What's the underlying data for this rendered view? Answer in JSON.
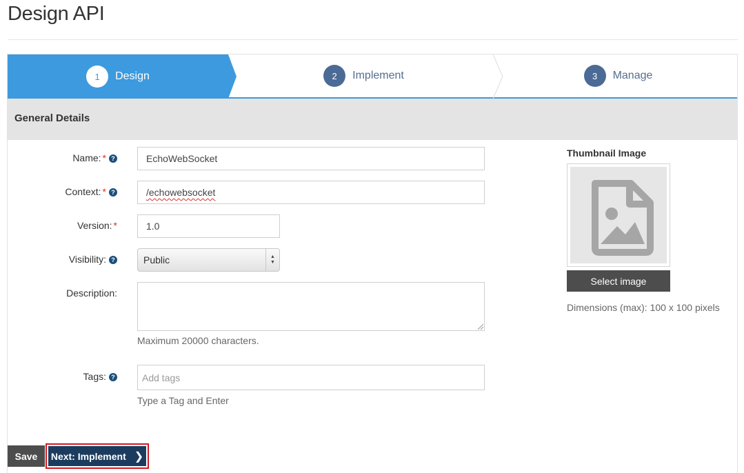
{
  "page": {
    "title": "Design API"
  },
  "wizard": {
    "steps": [
      {
        "number": "1",
        "label": "Design",
        "active": true
      },
      {
        "number": "2",
        "label": "Implement",
        "active": false
      },
      {
        "number": "3",
        "label": "Manage",
        "active": false
      }
    ]
  },
  "section": {
    "title": "General Details"
  },
  "form": {
    "name": {
      "label": "Name:",
      "value": "EchoWebSocket",
      "required": true
    },
    "context": {
      "label": "Context:",
      "value": "/echowebsocket",
      "required": true
    },
    "version": {
      "label": "Version:",
      "value": "1.0",
      "required": true
    },
    "visibility": {
      "label": "Visibility:",
      "value": "Public"
    },
    "description": {
      "label": "Description:",
      "value": "",
      "hint": "Maximum 20000 characters."
    },
    "tags": {
      "label": "Tags:",
      "placeholder": "Add tags",
      "hint": "Type a Tag and Enter"
    },
    "required_mark": "*",
    "help_glyph": "?"
  },
  "thumbnail": {
    "title": "Thumbnail Image",
    "button_label": "Select image",
    "dimensions_text": "Dimensions (max): 100 x 100 pixels"
  },
  "actions": {
    "save_label": "Save",
    "next_label": "Next: Implement"
  },
  "colors": {
    "accent": "#3d9ade",
    "step_circle": "#4b6b96",
    "next_button": "#1c3c5f",
    "highlight_border": "#d3181f",
    "required": "#d9302c"
  }
}
